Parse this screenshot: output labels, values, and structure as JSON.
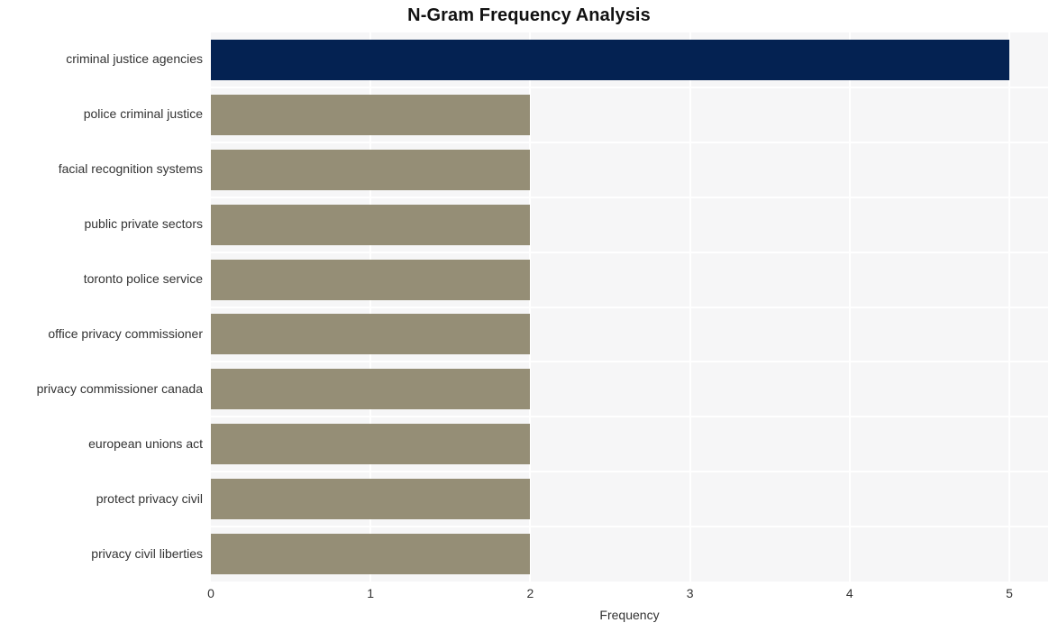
{
  "chart_data": {
    "type": "bar",
    "orientation": "horizontal",
    "title": "N-Gram Frequency Analysis",
    "xlabel": "Frequency",
    "ylabel": "",
    "xlim": [
      0,
      5
    ],
    "xticks": [
      "0",
      "1",
      "2",
      "3",
      "4",
      "5"
    ],
    "grid": true,
    "legend": null,
    "categories": [
      "criminal justice agencies",
      "police criminal justice",
      "facial recognition systems",
      "public private sectors",
      "toronto police service",
      "office privacy commissioner",
      "privacy commissioner canada",
      "european unions act",
      "protect privacy civil",
      "privacy civil liberties"
    ],
    "values": [
      5,
      2,
      2,
      2,
      2,
      2,
      2,
      2,
      2,
      2
    ],
    "colors": {
      "highlight_bar": "#042252",
      "default_bar": "#958e76",
      "plot_background": "#f6f6f7",
      "figure_background": "#ffffff",
      "grid_line": "#ffffff",
      "tick_text": "#333333",
      "title_text": "#111111"
    }
  }
}
